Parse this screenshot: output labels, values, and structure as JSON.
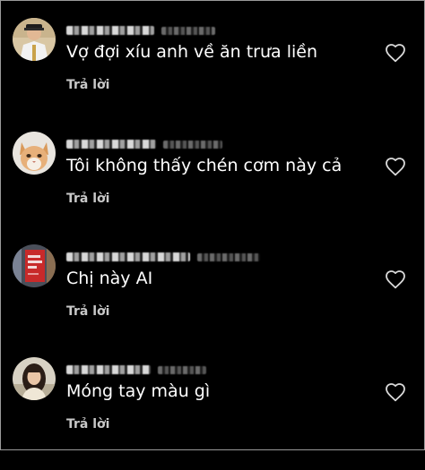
{
  "comments": [
    {
      "text": "Vợ đợi xíu anh về ăn trưa liền",
      "reply_label": "Trả lời",
      "avatar_icon": "avatar-uniform-man",
      "like_icon": "heart-outline-icon"
    },
    {
      "text": "Tôi không thấy chén cơm này cả",
      "reply_label": "Trả lời",
      "avatar_icon": "avatar-cat",
      "like_icon": "heart-outline-icon"
    },
    {
      "text": "Chị này AI",
      "reply_label": "Trả lời",
      "avatar_icon": "avatar-book",
      "like_icon": "heart-outline-icon"
    },
    {
      "text": "Móng tay màu gì",
      "reply_label": "Trả lời",
      "avatar_icon": "avatar-girl",
      "like_icon": "heart-outline-icon"
    }
  ],
  "colors": {
    "background": "#000000",
    "text": "#ffffff",
    "reply": "#c8c8c8",
    "heart": "#d9d9d9"
  }
}
